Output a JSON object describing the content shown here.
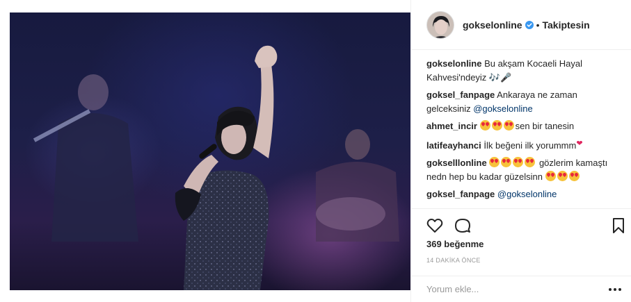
{
  "post": {
    "image_alt": "Konser fotoğrafı",
    "username": "gokselonline",
    "separator": "•",
    "follow_status": "Takiptesin"
  },
  "comments": [
    {
      "user": "gokselonline",
      "text": "Bu akşam Kocaeli Hayal Kahvesi'ndeyiz 🎶🎤"
    },
    {
      "user": "goksel_fanpage",
      "text": "Ankaraya ne zaman gelceksiniz ",
      "mention": "@gokselonline"
    },
    {
      "user": "ahmet_incir",
      "text": "sen bir tanesin"
    },
    {
      "user": "latifeayhanci",
      "text": "İlk beğeni ilk yorummm"
    },
    {
      "user": "gokselllonline",
      "text": "gözlerim kamaştı nedn hep bu kadar güzelsinn"
    },
    {
      "user": "goksel_fanpage",
      "mention": "@gokselonline"
    }
  ],
  "stats": {
    "likes": "369 beğenme",
    "time": "14 DAKİKA ÖNCE"
  },
  "add_comment": {
    "placeholder": "Yorum ekle..."
  },
  "icons": {
    "like": "heart-icon",
    "comment": "comment-icon",
    "save": "bookmark-icon",
    "verified": "verified-badge-icon",
    "more": "more-options-icon",
    "heart_emoji": "heart-eyes-emoji"
  },
  "colors": {
    "link": "#003569",
    "verified": "#3897f0",
    "muted": "#999999"
  }
}
